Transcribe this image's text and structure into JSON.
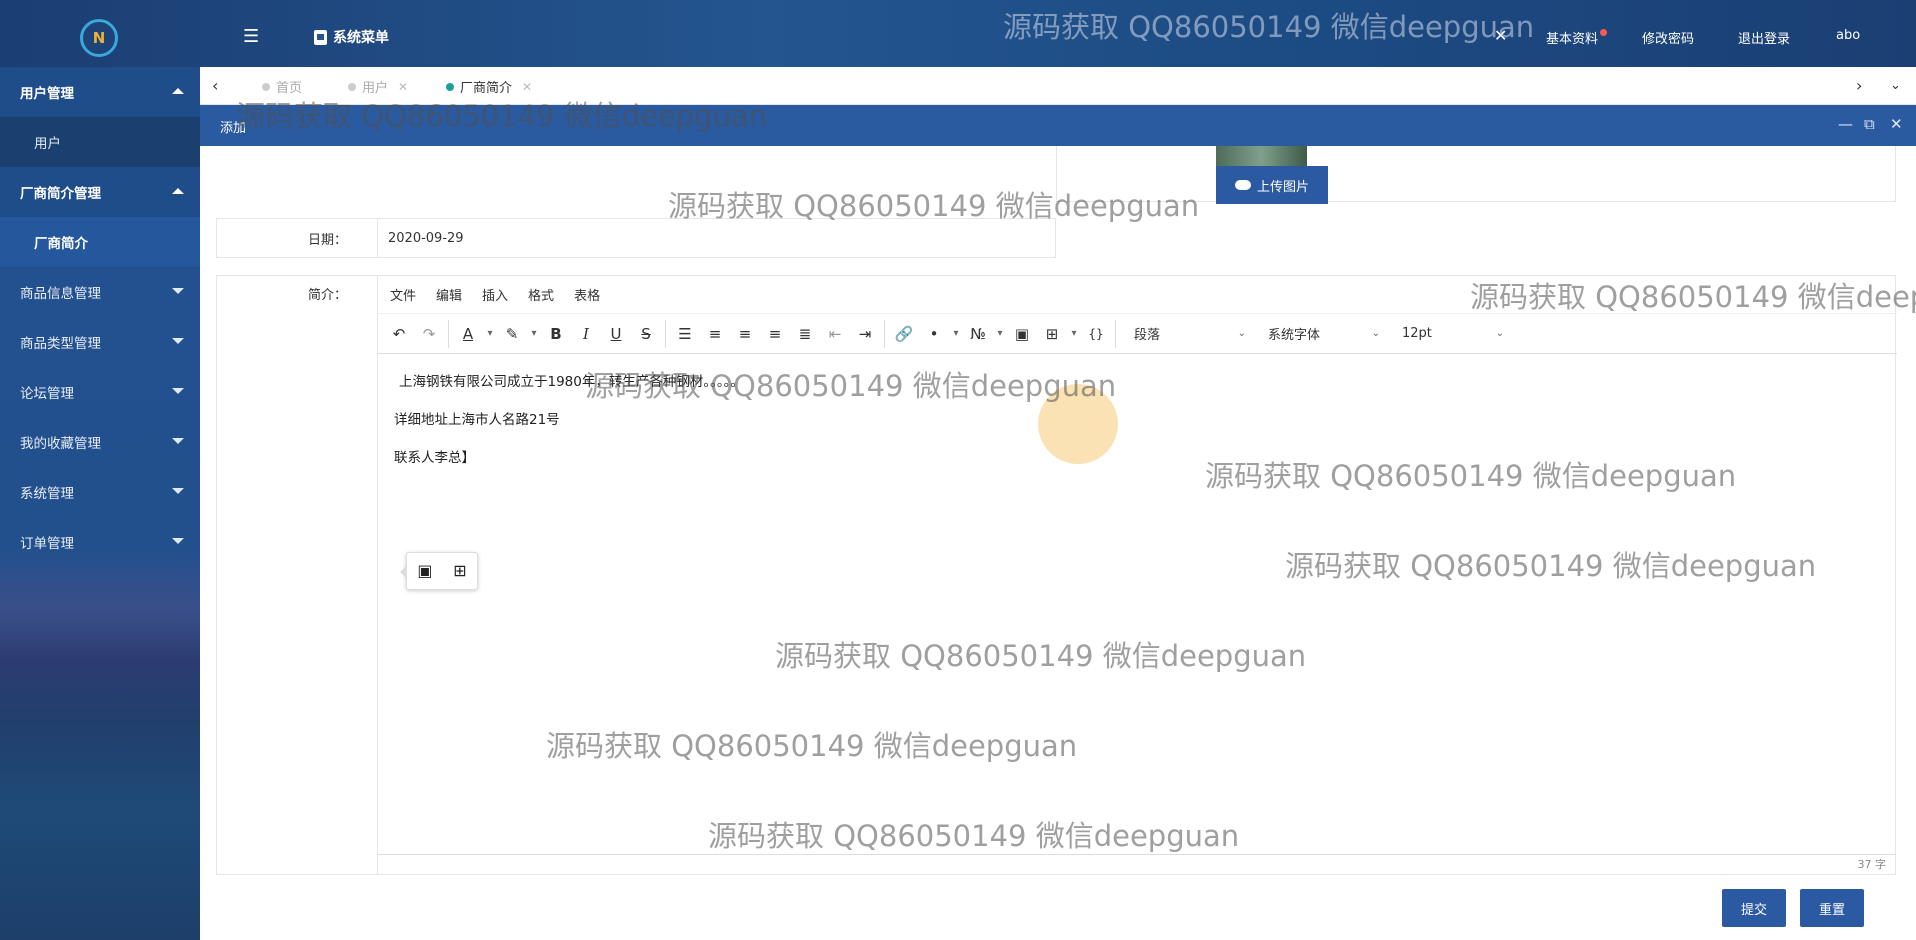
{
  "header": {
    "logo_text": "N",
    "menu_toggle_glyph": "☰",
    "system_menu_label": "系统菜单",
    "right": {
      "basic_info": "基本资料",
      "change_password": "修改密码",
      "logout": "退出登录",
      "username": "abo"
    }
  },
  "sidebar": {
    "groups": [
      {
        "label": "用户管理",
        "open": true,
        "children": [
          "用户"
        ]
      },
      {
        "label": "厂商简介管理",
        "open": true,
        "children": [
          "厂商简介"
        ]
      },
      {
        "label": "商品信息管理",
        "open": false
      },
      {
        "label": "商品类型管理",
        "open": false
      },
      {
        "label": "论坛管理",
        "open": false
      },
      {
        "label": "我的收藏管理",
        "open": false
      },
      {
        "label": "系统管理",
        "open": false
      },
      {
        "label": "订单管理",
        "open": false
      }
    ]
  },
  "tabs": [
    {
      "label": "首页",
      "closable": false,
      "active": false
    },
    {
      "label": "用户",
      "closable": true,
      "active": false
    },
    {
      "label": "厂商简介",
      "closable": true,
      "active": true
    }
  ],
  "dialog": {
    "title": "添加"
  },
  "form": {
    "upload_label": "上传图片",
    "date_label": "日期：",
    "date_value": "2020-09-29",
    "intro_label": "简介："
  },
  "editor": {
    "menus": [
      "文件",
      "编辑",
      "插入",
      "格式",
      "表格"
    ],
    "block_format": "段落",
    "font_family": "系统字体",
    "font_size": "12pt",
    "paragraphs": [
      "上海钢铁有限公司成立于1980年，转生产各种钢材。。。。。",
      "详细地址上海市人名路21号",
      "联系人李总】"
    ],
    "word_count": "37 字"
  },
  "actions": {
    "submit": "提交",
    "reset": "重置"
  },
  "watermark_text": "源码获取 QQ86050149 微信deepguan",
  "colors": {
    "primary": "#2b5aa3",
    "header": "#24558f",
    "sidebar": "#22508d",
    "tab_active_dot": "#1aa094"
  }
}
